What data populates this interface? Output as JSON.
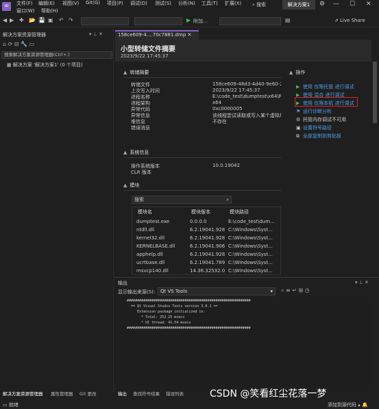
{
  "menu": {
    "row1": [
      "文件(F)",
      "编辑(E)",
      "视图(V)",
      "Git(G)",
      "项目(P)",
      "调试(D)",
      "测试(S)",
      "分析(N)",
      "工具(T)",
      "扩展(X)"
    ],
    "row2": [
      "窗口(W)",
      "帮助(H)"
    ],
    "search": "搜索",
    "solution_name": "解决方案1"
  },
  "toolbar": {
    "attach": "附加...",
    "live_share": "Live Share"
  },
  "solution_explorer": {
    "title": "解决方案资源管理器",
    "search_placeholder": "搜索解决方案资源管理器(Ctrl+;)",
    "tree_root": "解决方案 '解决方案1' (0 个项目)",
    "bottom_tabs": [
      "解决方案资源管理器",
      "属性管理器",
      "Git 更改"
    ]
  },
  "document": {
    "tab": "158ce609-4....70c7881.dmp",
    "title": "小型转储文件摘要",
    "date": "2023/9/22 17:45:37",
    "dump_section": "转储摘要",
    "dump_rows": [
      {
        "k": "转储文件",
        "v": "158ce609-48d3-4d40-9e60-25"
      },
      {
        "k": "上次写入时间",
        "v": "2023/9/22 17:45:37"
      },
      {
        "k": "进程名称",
        "v": "E:\\code_test\\dumptest\\x64\\Re"
      },
      {
        "k": "进程架构",
        "v": "x64"
      },
      {
        "k": "异常代码",
        "v": "0xc0000005"
      },
      {
        "k": "异常信息",
        "v": "该线程尝试读取或写入某个虚拟地址，对"
      },
      {
        "k": "堆信息",
        "v": "不存在"
      },
      {
        "k": "错误消息",
        "v": ""
      }
    ],
    "system_section": "系统信息",
    "system_rows": [
      {
        "k": "操作系统版本",
        "v": "10.0.19042"
      },
      {
        "k": "CLR 版本",
        "v": ""
      }
    ],
    "modules_section": "模块",
    "modules_search": "搜索",
    "modules_headers": [
      "模块名",
      "模块版本",
      "模块路径"
    ],
    "modules": [
      {
        "name": "dumptest.exe",
        "ver": "0.0.0.0",
        "path": "E:\\code_test\\dum..."
      },
      {
        "name": "ntdll.dll",
        "ver": "6.2.19041.928",
        "path": "C:\\Windows\\Syst..."
      },
      {
        "name": "kernel32.dll",
        "ver": "6.2.19041.928",
        "path": "C:\\Windows\\Syst..."
      },
      {
        "name": "KERNELBASE.dll",
        "ver": "6.2.19041.906",
        "path": "C:\\Windows\\Syst..."
      },
      {
        "name": "apphelp.dll",
        "ver": "6.2.19041.928",
        "path": "C:\\Windows\\Syst..."
      },
      {
        "name": "ucrtbase.dll",
        "ver": "6.2.19041.789",
        "path": "C:\\Windows\\Syst..."
      },
      {
        "name": "msvcp140.dll",
        "ver": "14.36.32532.0",
        "path": "C:\\Windows\\Syst..."
      }
    ],
    "actions_title": "操作",
    "actions": [
      {
        "label": "使用 仅限托管 进行调试",
        "icon": "play-icon"
      },
      {
        "label": "使用 混合 进行调试",
        "icon": "play-icon"
      },
      {
        "label": "使用 仅限本机 进行调试",
        "icon": "play-icon"
      },
      {
        "label": "运行诊断分析",
        "icon": "diagnostics-icon"
      },
      {
        "label": "托管内存调试不可用",
        "icon": "memory-icon"
      },
      {
        "label": "设置符号路径",
        "icon": "symbol-icon"
      },
      {
        "label": "全部复制到剪贴板",
        "icon": "copy-icon"
      }
    ]
  },
  "output": {
    "title": "输出",
    "source_label": "显示输出来源(S):",
    "source_value": "Qt VS Tools",
    "lines": [
      "   ############################################################",
      "     == Qt Visual Studio Tools version 3.0.1 ==",
      "        Extension package initialized in:",
      "          * Total: 252.25 msecs",
      "          * UI thread: 41.54 msecs",
      "   ############################################################"
    ],
    "bottom_tabs": [
      "输出",
      "查找符号结果",
      "错误列表"
    ]
  },
  "status": {
    "left": "就绪",
    "right": "添加到源代码"
  },
  "watermark": "CSDN @笑看红尘花落一梦",
  "colors": {
    "accent": "#8661c5",
    "link": "#4ea0ea",
    "highlight": "#e02020",
    "play": "#3fb950"
  }
}
